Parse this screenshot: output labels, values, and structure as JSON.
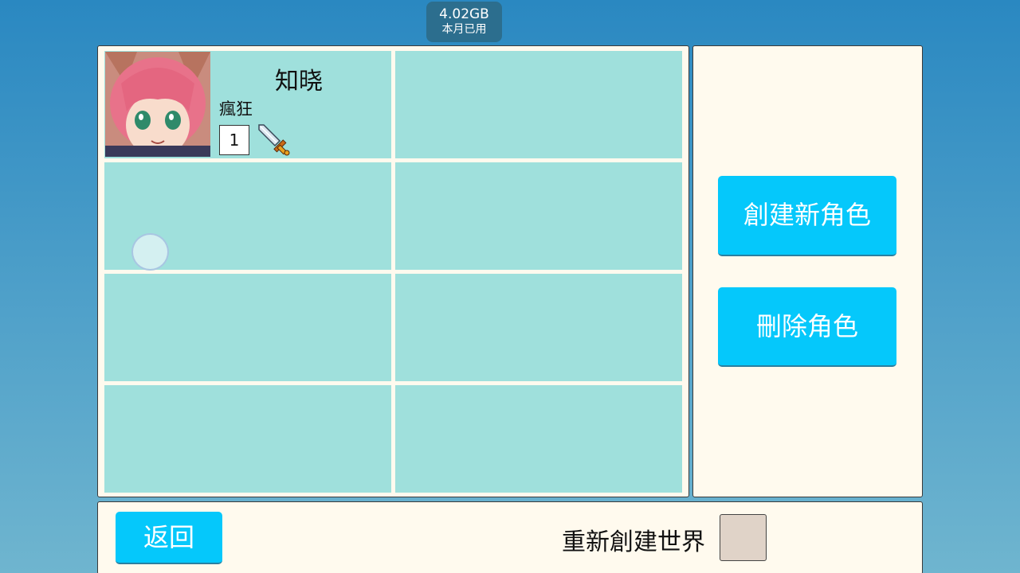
{
  "data_usage": {
    "amount": "4.02GB",
    "caption": "本月已用"
  },
  "characters": {
    "slots": [
      {
        "name": "知晓",
        "title": "瘋狂",
        "level": "1",
        "weapon_icon": "sword-icon",
        "portrait": "anime-girl-pink-hair"
      },
      {},
      {},
      {},
      {},
      {},
      {},
      {}
    ]
  },
  "actions": {
    "create": "創建新角色",
    "delete": "刪除角色"
  },
  "footer": {
    "back": "返回",
    "recreate_world": "重新創建世界"
  },
  "colors": {
    "slot_bg": "#9fe0dc",
    "button": "#05c8fb",
    "panel_bg": "#fffaee"
  }
}
